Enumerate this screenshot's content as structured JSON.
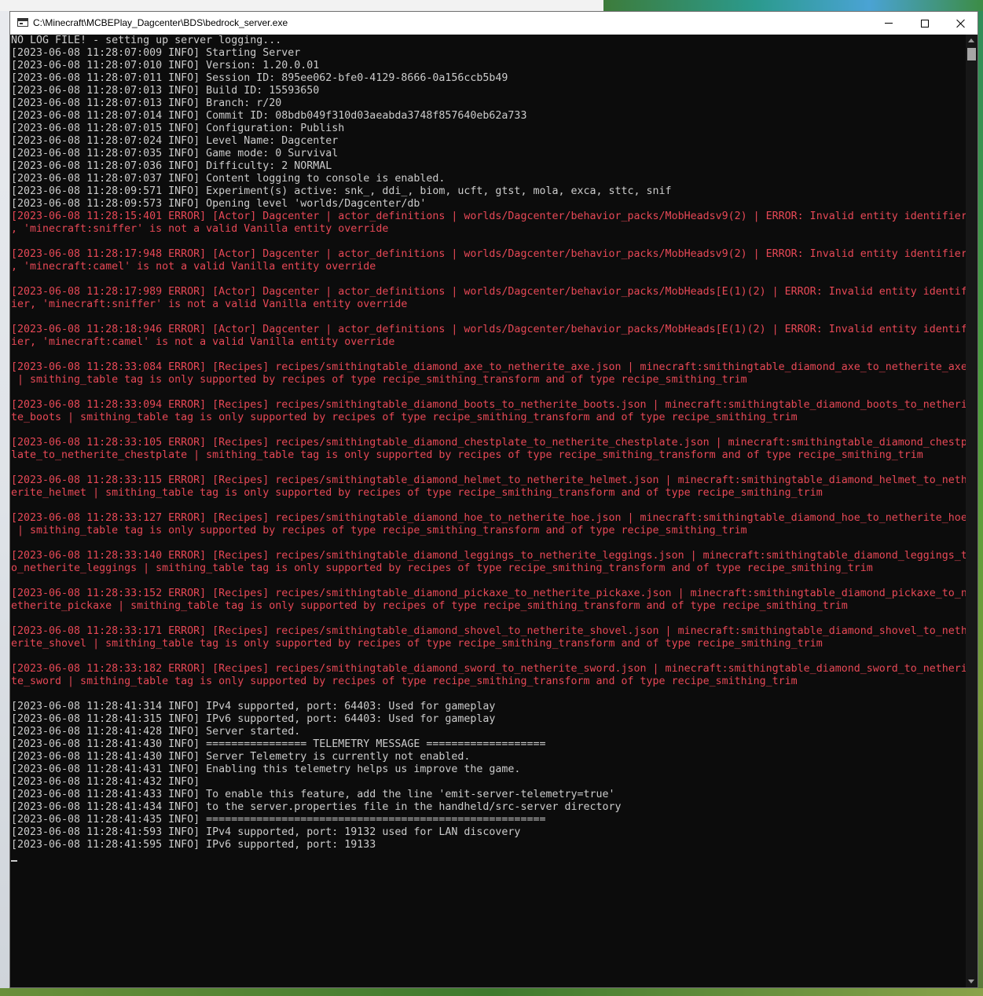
{
  "window": {
    "title": "C:\\Minecraft\\MCBEPlay_Dagcenter\\BDS\\bedrock_server.exe"
  },
  "controls": {
    "minimize": "minimize",
    "maximize": "maximize",
    "close": "close"
  },
  "colors": {
    "info": "#cccccc",
    "error": "#e74856",
    "background": "#0c0c0c"
  },
  "console": {
    "lines": [
      {
        "text": "NO LOG FILE! - setting up server logging...",
        "level": "info"
      },
      {
        "text": "[2023-06-08 11:28:07:009 INFO] Starting Server",
        "level": "info"
      },
      {
        "text": "[2023-06-08 11:28:07:010 INFO] Version: 1.20.0.01",
        "level": "info"
      },
      {
        "text": "[2023-06-08 11:28:07:011 INFO] Session ID: 895ee062-bfe0-4129-8666-0a156ccb5b49",
        "level": "info"
      },
      {
        "text": "[2023-06-08 11:28:07:013 INFO] Build ID: 15593650",
        "level": "info"
      },
      {
        "text": "[2023-06-08 11:28:07:013 INFO] Branch: r/20",
        "level": "info"
      },
      {
        "text": "[2023-06-08 11:28:07:014 INFO] Commit ID: 08bdb049f310d03aeabda3748f857640eb62a733",
        "level": "info"
      },
      {
        "text": "[2023-06-08 11:28:07:015 INFO] Configuration: Publish",
        "level": "info"
      },
      {
        "text": "[2023-06-08 11:28:07:024 INFO] Level Name: Dagcenter",
        "level": "info"
      },
      {
        "text": "[2023-06-08 11:28:07:035 INFO] Game mode: 0 Survival",
        "level": "info"
      },
      {
        "text": "[2023-06-08 11:28:07:036 INFO] Difficulty: 2 NORMAL",
        "level": "info"
      },
      {
        "text": "[2023-06-08 11:28:07:037 INFO] Content logging to console is enabled.",
        "level": "info"
      },
      {
        "text": "[2023-06-08 11:28:09:571 INFO] Experiment(s) active: snk_, ddi_, biom, ucft, gtst, mola, exca, sttc, snif",
        "level": "info"
      },
      {
        "text": "[2023-06-08 11:28:09:573 INFO] Opening level 'worlds/Dagcenter/db'",
        "level": "info"
      },
      {
        "text": "[2023-06-08 11:28:15:401 ERROR] [Actor] Dagcenter | actor_definitions | worlds/Dagcenter/behavior_packs/MobHeadsv9(2) | ERROR: Invalid entity identifier",
        "level": "error"
      },
      {
        "text": ", 'minecraft:sniffer' is not a valid Vanilla entity override",
        "level": "error"
      },
      {
        "text": "",
        "level": "info"
      },
      {
        "text": "[2023-06-08 11:28:17:948 ERROR] [Actor] Dagcenter | actor_definitions | worlds/Dagcenter/behavior_packs/MobHeadsv9(2) | ERROR: Invalid entity identifier",
        "level": "error"
      },
      {
        "text": ", 'minecraft:camel' is not a valid Vanilla entity override",
        "level": "error"
      },
      {
        "text": "",
        "level": "info"
      },
      {
        "text": "[2023-06-08 11:28:17:989 ERROR] [Actor] Dagcenter | actor_definitions | worlds/Dagcenter/behavior_packs/MobHeads[E(1)(2) | ERROR: Invalid entity identif",
        "level": "error"
      },
      {
        "text": "ier, 'minecraft:sniffer' is not a valid Vanilla entity override",
        "level": "error"
      },
      {
        "text": "",
        "level": "info"
      },
      {
        "text": "[2023-06-08 11:28:18:946 ERROR] [Actor] Dagcenter | actor_definitions | worlds/Dagcenter/behavior_packs/MobHeads[E(1)(2) | ERROR: Invalid entity identif",
        "level": "error"
      },
      {
        "text": "ier, 'minecraft:camel' is not a valid Vanilla entity override",
        "level": "error"
      },
      {
        "text": "",
        "level": "info"
      },
      {
        "text": "[2023-06-08 11:28:33:084 ERROR] [Recipes] recipes/smithingtable_diamond_axe_to_netherite_axe.json | minecraft:smithingtable_diamond_axe_to_netherite_axe",
        "level": "error"
      },
      {
        "text": " | smithing_table tag is only supported by recipes of type recipe_smithing_transform and of type recipe_smithing_trim",
        "level": "error"
      },
      {
        "text": "",
        "level": "info"
      },
      {
        "text": "[2023-06-08 11:28:33:094 ERROR] [Recipes] recipes/smithingtable_diamond_boots_to_netherite_boots.json | minecraft:smithingtable_diamond_boots_to_netheri",
        "level": "error"
      },
      {
        "text": "te_boots | smithing_table tag is only supported by recipes of type recipe_smithing_transform and of type recipe_smithing_trim",
        "level": "error"
      },
      {
        "text": "",
        "level": "info"
      },
      {
        "text": "[2023-06-08 11:28:33:105 ERROR] [Recipes] recipes/smithingtable_diamond_chestplate_to_netherite_chestplate.json | minecraft:smithingtable_diamond_chestp",
        "level": "error"
      },
      {
        "text": "late_to_netherite_chestplate | smithing_table tag is only supported by recipes of type recipe_smithing_transform and of type recipe_smithing_trim",
        "level": "error"
      },
      {
        "text": "",
        "level": "info"
      },
      {
        "text": "[2023-06-08 11:28:33:115 ERROR] [Recipes] recipes/smithingtable_diamond_helmet_to_netherite_helmet.json | minecraft:smithingtable_diamond_helmet_to_neth",
        "level": "error"
      },
      {
        "text": "erite_helmet | smithing_table tag is only supported by recipes of type recipe_smithing_transform and of type recipe_smithing_trim",
        "level": "error"
      },
      {
        "text": "",
        "level": "info"
      },
      {
        "text": "[2023-06-08 11:28:33:127 ERROR] [Recipes] recipes/smithingtable_diamond_hoe_to_netherite_hoe.json | minecraft:smithingtable_diamond_hoe_to_netherite_hoe",
        "level": "error"
      },
      {
        "text": " | smithing_table tag is only supported by recipes of type recipe_smithing_transform and of type recipe_smithing_trim",
        "level": "error"
      },
      {
        "text": "",
        "level": "info"
      },
      {
        "text": "[2023-06-08 11:28:33:140 ERROR] [Recipes] recipes/smithingtable_diamond_leggings_to_netherite_leggings.json | minecraft:smithingtable_diamond_leggings_t",
        "level": "error"
      },
      {
        "text": "o_netherite_leggings | smithing_table tag is only supported by recipes of type recipe_smithing_transform and of type recipe_smithing_trim",
        "level": "error"
      },
      {
        "text": "",
        "level": "info"
      },
      {
        "text": "[2023-06-08 11:28:33:152 ERROR] [Recipes] recipes/smithingtable_diamond_pickaxe_to_netherite_pickaxe.json | minecraft:smithingtable_diamond_pickaxe_to_n",
        "level": "error"
      },
      {
        "text": "etherite_pickaxe | smithing_table tag is only supported by recipes of type recipe_smithing_transform and of type recipe_smithing_trim",
        "level": "error"
      },
      {
        "text": "",
        "level": "info"
      },
      {
        "text": "[2023-06-08 11:28:33:171 ERROR] [Recipes] recipes/smithingtable_diamond_shovel_to_netherite_shovel.json | minecraft:smithingtable_diamond_shovel_to_neth",
        "level": "error"
      },
      {
        "text": "erite_shovel | smithing_table tag is only supported by recipes of type recipe_smithing_transform and of type recipe_smithing_trim",
        "level": "error"
      },
      {
        "text": "",
        "level": "info"
      },
      {
        "text": "[2023-06-08 11:28:33:182 ERROR] [Recipes] recipes/smithingtable_diamond_sword_to_netherite_sword.json | minecraft:smithingtable_diamond_sword_to_netheri",
        "level": "error"
      },
      {
        "text": "te_sword | smithing_table tag is only supported by recipes of type recipe_smithing_transform and of type recipe_smithing_trim",
        "level": "error"
      },
      {
        "text": "",
        "level": "info"
      },
      {
        "text": "[2023-06-08 11:28:41:314 INFO] IPv4 supported, port: 64403: Used for gameplay",
        "level": "info"
      },
      {
        "text": "[2023-06-08 11:28:41:315 INFO] IPv6 supported, port: 64403: Used for gameplay",
        "level": "info"
      },
      {
        "text": "[2023-06-08 11:28:41:428 INFO] Server started.",
        "level": "info"
      },
      {
        "text": "[2023-06-08 11:28:41:430 INFO] ================ TELEMETRY MESSAGE ===================",
        "level": "info"
      },
      {
        "text": "[2023-06-08 11:28:41:430 INFO] Server Telemetry is currently not enabled.",
        "level": "info"
      },
      {
        "text": "[2023-06-08 11:28:41:431 INFO] Enabling this telemetry helps us improve the game.",
        "level": "info"
      },
      {
        "text": "[2023-06-08 11:28:41:432 INFO]",
        "level": "info"
      },
      {
        "text": "[2023-06-08 11:28:41:433 INFO] To enable this feature, add the line 'emit-server-telemetry=true'",
        "level": "info"
      },
      {
        "text": "[2023-06-08 11:28:41:434 INFO] to the server.properties file in the handheld/src-server directory",
        "level": "info"
      },
      {
        "text": "[2023-06-08 11:28:41:435 INFO] ======================================================",
        "level": "info"
      },
      {
        "text": "[2023-06-08 11:28:41:593 INFO] IPv4 supported, port: 19132 used for LAN discovery",
        "level": "info"
      },
      {
        "text": "[2023-06-08 11:28:41:595 INFO] IPv6 supported, port: 19133",
        "level": "info"
      }
    ]
  }
}
